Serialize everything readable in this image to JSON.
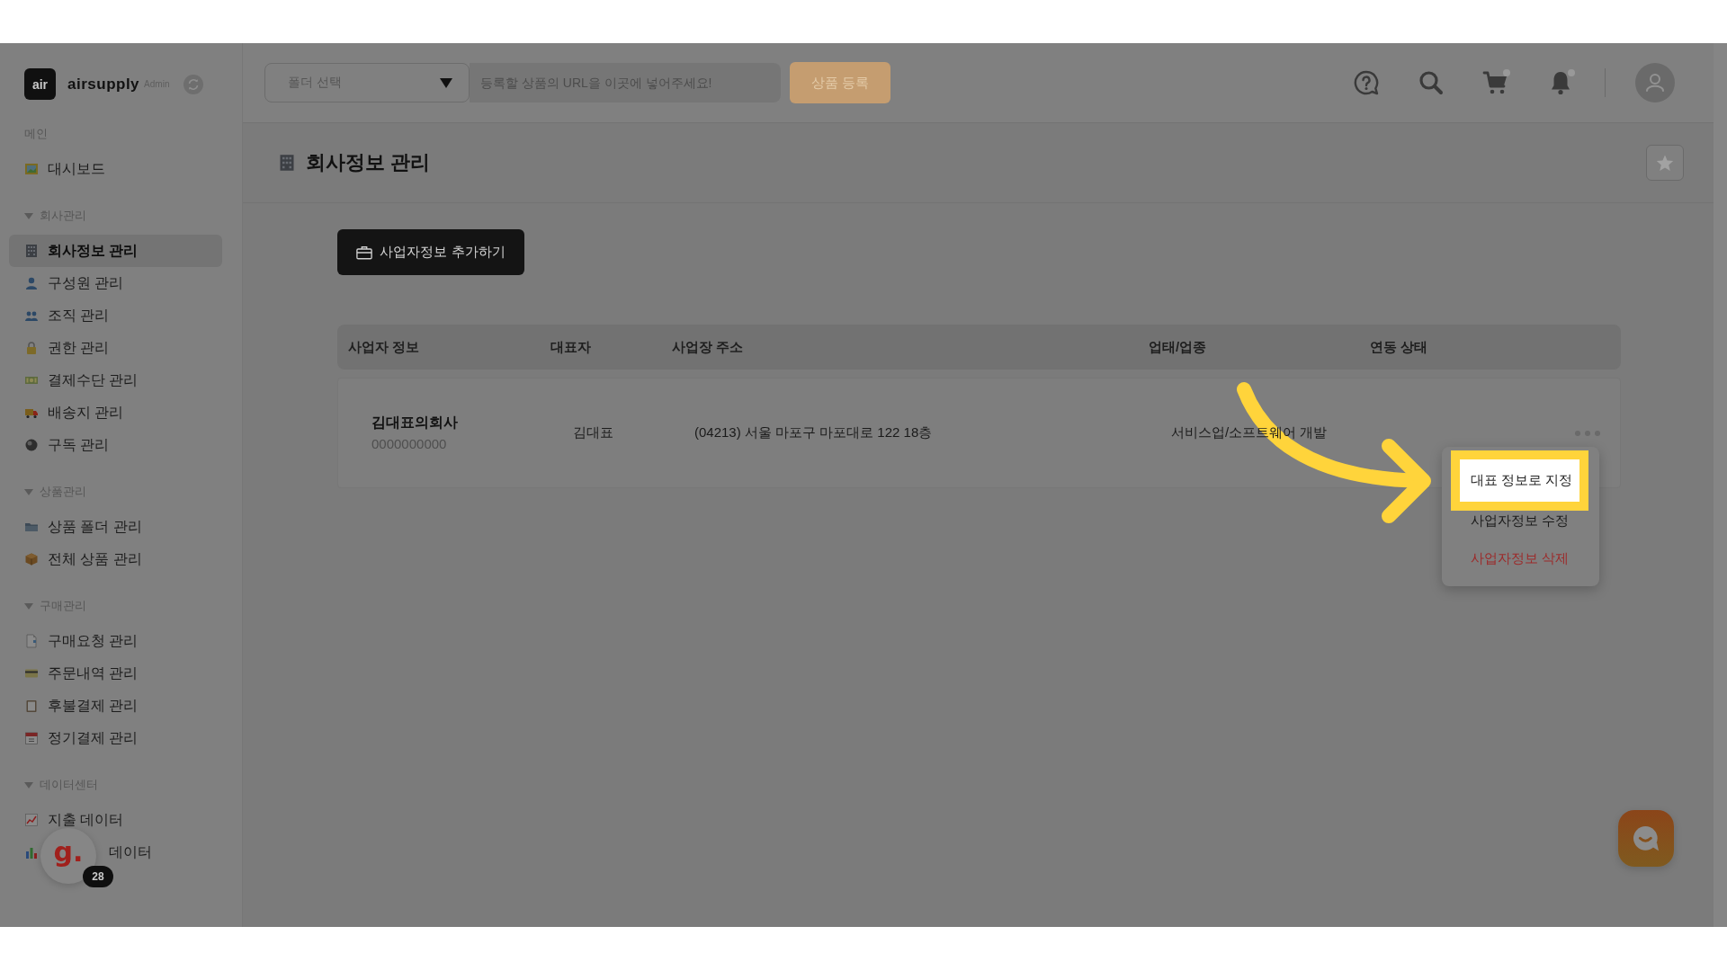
{
  "brand": {
    "mark": "air",
    "name": "airsupply",
    "tag": "Admin"
  },
  "sidebar": {
    "sections": [
      {
        "title": "메인",
        "kind": "plain",
        "items": [
          {
            "label": "대시보드",
            "selected": false
          }
        ]
      },
      {
        "title": "회사관리",
        "kind": "group",
        "expanded": true,
        "items": [
          {
            "label": "회사정보 관리",
            "selected": true
          },
          {
            "label": "구성원 관리",
            "selected": false
          },
          {
            "label": "조직 관리",
            "selected": false
          },
          {
            "label": "권한 관리",
            "selected": false
          },
          {
            "label": "결제수단 관리",
            "selected": false
          },
          {
            "label": "배송지 관리",
            "selected": false
          },
          {
            "label": "구독 관리",
            "selected": false
          }
        ]
      },
      {
        "title": "상품관리",
        "kind": "group",
        "expanded": true,
        "items": [
          {
            "label": "상품 폴더 관리",
            "selected": false
          },
          {
            "label": "전체 상품 관리",
            "selected": false
          }
        ]
      },
      {
        "title": "구매관리",
        "kind": "group",
        "expanded": true,
        "items": [
          {
            "label": "구매요청 관리",
            "selected": false
          },
          {
            "label": "주문내역 관리",
            "selected": false
          },
          {
            "label": "후불결제 관리",
            "selected": false
          },
          {
            "label": "정기결제 관리",
            "selected": false
          }
        ]
      },
      {
        "title": "데이터센터",
        "kind": "group",
        "expanded": true,
        "items": [
          {
            "label": "지출 데이터",
            "selected": false,
            "kind": "link"
          },
          {
            "label": "데이터",
            "selected": false,
            "kind": "covered"
          }
        ]
      }
    ]
  },
  "topbar": {
    "folder_select": {
      "placeholder": "폴더 선택"
    },
    "url_input": {
      "placeholder": "등록할 상품의 URL을 이곳에 넣어주세요!"
    },
    "register_button": "상품 등록",
    "cart": {
      "alert_dot": true
    },
    "notifications": {
      "alert_dot": true
    }
  },
  "page": {
    "title": "회사정보 관리",
    "starred": false
  },
  "add_button": "사업자정보 추가하기",
  "table": {
    "columns": [
      "사업자 정보",
      "대표자",
      "사업장 주소",
      "업태/업종",
      "연동 상태"
    ],
    "rows": [
      {
        "company": "김대표의회사",
        "business_number": "0000000000",
        "representative": "김대표",
        "address": "(04213) 서울 마포구 마포대로 122 18층",
        "business_type": "서비스업/소프트웨어 개발"
      }
    ]
  },
  "row_menu": {
    "items": [
      {
        "label": "대표 정보로 지정",
        "kind": "normal",
        "highlighted": true
      },
      {
        "label": "사업자정보 수정",
        "kind": "normal",
        "highlighted": false
      },
      {
        "label": "사업자정보 삭제",
        "kind": "danger",
        "highlighted": false
      }
    ]
  },
  "floating_widget": {
    "logo": "g.",
    "badge": "28"
  }
}
